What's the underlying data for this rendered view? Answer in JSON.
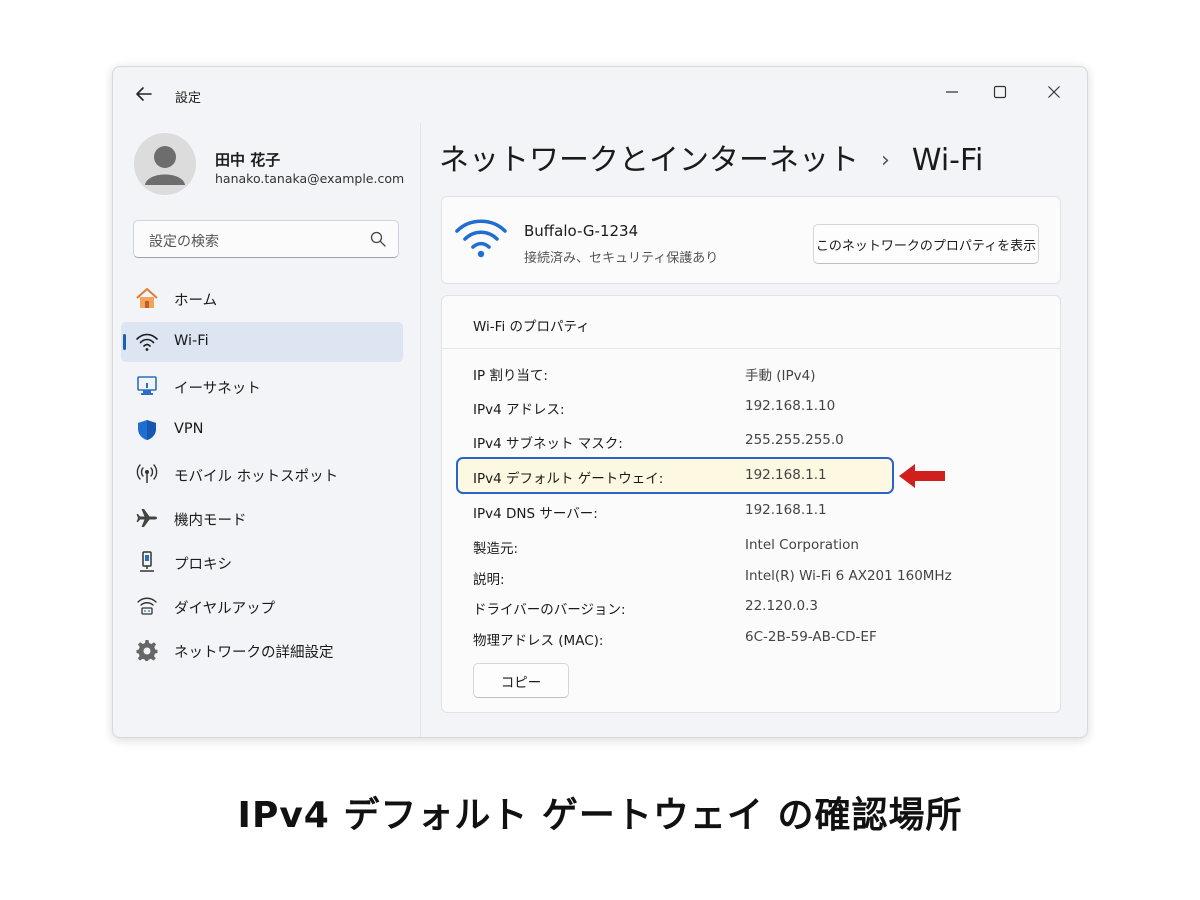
{
  "window": {
    "app_title": "設定"
  },
  "user": {
    "name": "田中 花子",
    "email": "hanako.tanaka@example.com"
  },
  "search": {
    "placeholder": "設定の検索"
  },
  "sidebar": {
    "items": [
      {
        "label": "ホーム",
        "icon": "home-icon",
        "active": false
      },
      {
        "label": "Wi-Fi",
        "icon": "wifi-icon",
        "active": true
      },
      {
        "label": "イーサネット",
        "icon": "ethernet-icon",
        "active": false
      },
      {
        "label": "VPN",
        "icon": "shield-icon",
        "active": false
      },
      {
        "label": "モバイル ホットスポット",
        "icon": "hotspot-icon",
        "active": false
      },
      {
        "label": "機内モード",
        "icon": "airplane-icon",
        "active": false
      },
      {
        "label": "プロキシ",
        "icon": "proxy-icon",
        "active": false
      },
      {
        "label": "ダイヤルアップ",
        "icon": "dialup-icon",
        "active": false
      },
      {
        "label": "ネットワークの詳細設定",
        "icon": "gear-icon",
        "active": false
      }
    ]
  },
  "breadcrumb": {
    "parent": "ネットワークとインターネット",
    "separator": "›",
    "current": "Wi-Fi"
  },
  "network": {
    "name": "Buffalo-G-1234",
    "status": "接続済み、セキュリティ保護あり",
    "properties_button": "このネットワークのプロパティを表示"
  },
  "properties": {
    "header": "Wi-Fi のプロパティ",
    "rows": [
      {
        "label": "IP 割り当て:",
        "value": "手動 (IPv4)"
      },
      {
        "label": "IPv4 アドレス:",
        "value": "192.168.1.10"
      },
      {
        "label": "IPv4 サブネット マスク:",
        "value": "255.255.255.0"
      },
      {
        "label": "IPv4 デフォルト ゲートウェイ:",
        "value": "192.168.1.1",
        "highlighted": true
      },
      {
        "label": "IPv4 DNS サーバー:",
        "value": "192.168.1.1"
      },
      {
        "label": "製造元:",
        "value": "Intel Corporation"
      },
      {
        "label": "説明:",
        "value": "Intel(R) Wi-Fi 6 AX201 160MHz"
      },
      {
        "label": "ドライバーのバージョン:",
        "value": "22.120.0.3"
      },
      {
        "label": "物理アドレス (MAC):",
        "value": "6C-2B-59-AB-CD-EF"
      }
    ],
    "copy_button": "コピー"
  },
  "caption": "IPv4 デフォルト ゲートウェイ の確認場所",
  "colors": {
    "accent": "#1a5fb4",
    "highlight_border": "#2b63c6",
    "highlight_fill": "#fdf8e1",
    "arrow": "#d0201d"
  }
}
